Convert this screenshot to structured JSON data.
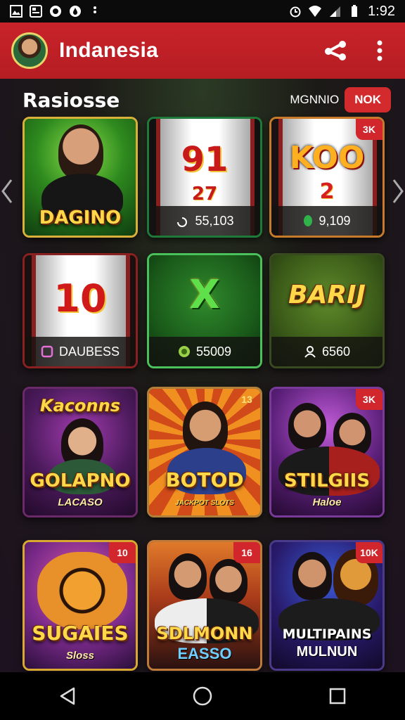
{
  "status_bar": {
    "time": "1:92",
    "left_icons": [
      "image-icon",
      "news-icon",
      "circle-b-icon",
      "drop-icon",
      "dots-icon"
    ],
    "right_icons": [
      "alarm-icon",
      "wifi-icon",
      "signal-icon",
      "battery-icon"
    ]
  },
  "app_bar": {
    "title": "Indanesia",
    "actions": [
      "share-icon",
      "more-vert-icon"
    ]
  },
  "section": {
    "title": "Rasiosse",
    "more_label": "MGNNIO",
    "badge_label": "NOK"
  },
  "tiles": [
    {
      "title": "DAGINO",
      "footer": "",
      "badge": "",
      "theme": "green"
    },
    {
      "title": "91",
      "title2": "27",
      "footer": "55,103",
      "footer_icon": "spin-icon",
      "badge": "",
      "theme": "reel"
    },
    {
      "title": "KOO",
      "title2": "2",
      "footer": "9,109",
      "footer_icon": "gem-icon",
      "badge": "3K",
      "theme": "reel"
    },
    {
      "title": "10",
      "footer": "DAUBESS",
      "footer_icon": "square-icon",
      "badge": "",
      "theme": "reel"
    },
    {
      "title": "X",
      "footer": "55009",
      "footer_icon": "coin-icon",
      "badge": "",
      "theme": "green"
    },
    {
      "title": "BARIJ",
      "footer": "6560",
      "footer_icon": "user-icon",
      "badge": "",
      "theme": "olive"
    },
    {
      "title": "GOLAPNO",
      "title_top": "Kaconns",
      "sub": "LACASO",
      "badge": "",
      "theme": "purple"
    },
    {
      "title": "BOTOD",
      "sub": "JACKPOT SLOTS",
      "badge": "13",
      "theme": "orange"
    },
    {
      "title": "STILGIIS",
      "sub": "Haloe",
      "badge": "3K",
      "theme": "violet"
    },
    {
      "title": "SUGAIES",
      "sub": "Sloss",
      "badge": "10",
      "theme": "gold"
    },
    {
      "title": "SDLMONN",
      "sub": "EASSO",
      "badge": "16",
      "theme": "street"
    },
    {
      "title": "MULTIPAINS",
      "sub": "MULNUN",
      "badge": "10K",
      "theme": "blue"
    }
  ],
  "colors": {
    "app_bar": "#c8232a",
    "badge": "#d22a2d",
    "gold": "#ffd84a"
  },
  "nav_bar": [
    "back-icon",
    "home-icon",
    "recents-icon"
  ]
}
